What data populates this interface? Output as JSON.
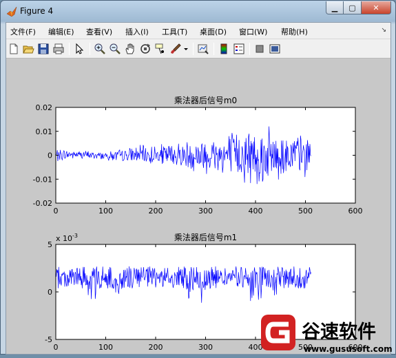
{
  "window": {
    "title": "Figure 4"
  },
  "menu": [
    "文件(F)",
    "编辑(E)",
    "查看(V)",
    "插入(I)",
    "工具(T)",
    "桌面(D)",
    "窗口(W)",
    "帮助(H)"
  ],
  "toolbar": [
    "new-figure-icon",
    "open-icon",
    "save-icon",
    "print-icon",
    "pointer-icon",
    "zoom-in-icon",
    "zoom-out-icon",
    "pan-icon",
    "rotate-icon",
    "data-cursor-icon",
    "brush-icon",
    "link-icon",
    "colorbar-icon",
    "legend-icon",
    "hide-plot-tools-icon",
    "show-plot-tools-icon"
  ],
  "watermark": {
    "brand": "谷速软件",
    "url": "www.gususoft.com"
  },
  "chart_data": [
    {
      "type": "line",
      "title": "乘法器后信号m0",
      "xlim": [
        0,
        600
      ],
      "ylim": [
        -0.02,
        0.02
      ],
      "xticks": [
        "0",
        "100",
        "200",
        "300",
        "400",
        "500",
        "600"
      ],
      "yticks": [
        "-0.02",
        "-0.01",
        "0",
        "0.01",
        "0.02"
      ],
      "series_color": "#0000ff",
      "n_points": 512,
      "envelope": {
        "x": [
          0,
          50,
          100,
          150,
          200,
          250,
          300,
          350,
          400,
          450,
          511
        ],
        "amplitude": [
          0.003,
          0.002,
          0.002,
          0.004,
          0.005,
          0.007,
          0.009,
          0.012,
          0.014,
          0.012,
          0.01
        ]
      }
    },
    {
      "type": "line",
      "title": "乘法器后信号m1",
      "xlim": [
        0,
        600
      ],
      "ylim": [
        -5,
        5
      ],
      "y_scale_label": "x 10",
      "y_scale_exponent": "-3",
      "xticks": [
        "0",
        "100",
        "200",
        "300",
        "400",
        "500",
        "600"
      ],
      "yticks": [
        "-5",
        "0",
        "5"
      ],
      "series_color": "#0000ff",
      "n_points": 512,
      "center": 1.5,
      "amplitude": 1.2,
      "dips": [
        {
          "x": [
            65,
            80
          ],
          "min": -1.0
        },
        {
          "x": [
            120,
            135
          ],
          "min": -0.5
        },
        {
          "x": [
            255,
            300
          ],
          "min": -1.3
        },
        {
          "x": [
            385,
            450
          ],
          "min": -1.5
        }
      ]
    }
  ]
}
